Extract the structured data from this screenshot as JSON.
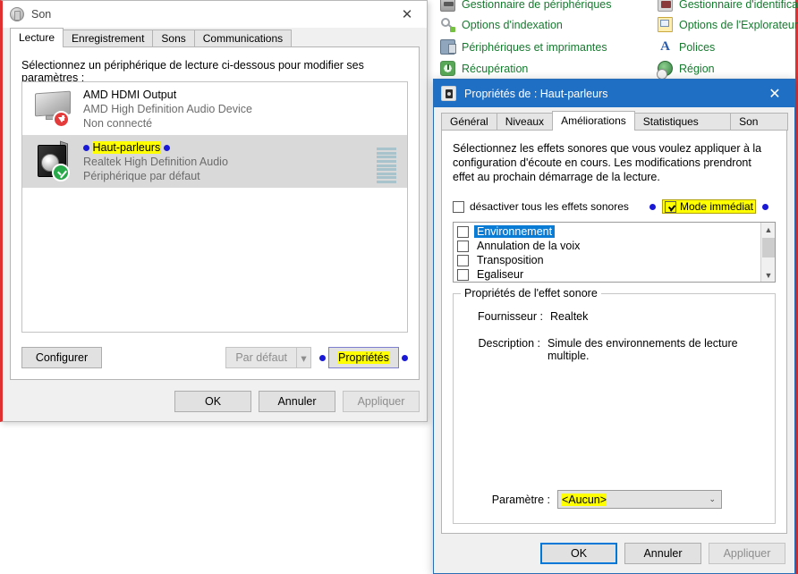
{
  "control_panel": {
    "left_column": [
      {
        "label": "Gestionnaire de périphériques",
        "icon": "device-manager-icon"
      },
      {
        "label": "Options d'indexation",
        "icon": "indexing-options-icon"
      },
      {
        "label": "Périphériques et imprimantes",
        "icon": "devices-printers-icon"
      },
      {
        "label": "Récupération",
        "icon": "recovery-icon"
      }
    ],
    "right_column": [
      {
        "label": "Gestionnaire d'identificat",
        "icon": "credential-manager-icon"
      },
      {
        "label": "Options de l'Explorateur",
        "icon": "explorer-options-icon"
      },
      {
        "label": "Polices",
        "icon": "fonts-icon"
      },
      {
        "label": "Région",
        "icon": "region-icon"
      }
    ]
  },
  "sound_window": {
    "title": "Son",
    "close_label": "✕",
    "tabs": [
      {
        "label": "Lecture",
        "active": true
      },
      {
        "label": "Enregistrement",
        "active": false
      },
      {
        "label": "Sons",
        "active": false
      },
      {
        "label": "Communications",
        "active": false
      }
    ],
    "instruction": "Sélectionnez un périphérique de lecture ci-dessous pour modifier ses paramètres :",
    "devices": [
      {
        "name": "AMD HDMI Output",
        "driver": "AMD High Definition Audio Device",
        "status": "Non connecté",
        "selected": false,
        "icon": "monitor-icon",
        "badge": "disconnected-badge"
      },
      {
        "name": "Haut-parleurs",
        "driver": "Realtek High Definition Audio",
        "status": "Périphérique par défaut",
        "selected": true,
        "icon": "speaker-icon",
        "badge": "default-device-check-badge"
      }
    ],
    "buttons": {
      "configure": "Configurer",
      "set_default": "Par défaut",
      "set_default_arrow": "▾",
      "properties": "Propriétés",
      "ok": "OK",
      "cancel": "Annuler",
      "apply": "Appliquer"
    }
  },
  "properties_dialog": {
    "title": "Propriétés de : Haut-parleurs",
    "close_label": "✕",
    "tabs": [
      {
        "label": "Général",
        "active": false
      },
      {
        "label": "Niveaux",
        "active": false
      },
      {
        "label": "Améliorations",
        "active": true
      },
      {
        "label": "Statistiques avancées",
        "active": false
      },
      {
        "label": "Son spatial",
        "active": false
      }
    ],
    "description": "Sélectionnez les effets sonores que vous voulez appliquer à la configuration d'écoute en cours. Les modifications prendront effet au prochain démarrage de la lecture.",
    "disable_all_label": "désactiver tous les effets sonores",
    "disable_all_checked": false,
    "immediate_mode_label": "Mode immédiat",
    "immediate_mode_checked": true,
    "effects": [
      {
        "label": "Environnement",
        "checked": false,
        "selected": true
      },
      {
        "label": "Annulation de la voix",
        "checked": false,
        "selected": false
      },
      {
        "label": "Transposition",
        "checked": false,
        "selected": false
      },
      {
        "label": "Egaliseur",
        "checked": false,
        "selected": false
      }
    ],
    "effect_properties": {
      "legend": "Propriétés de l'effet sonore",
      "provider_label": "Fournisseur :",
      "provider_value": "Realtek",
      "description_label": "Description :",
      "description_value": "Simule des environnements de lecture multiple.",
      "parameter_label": "Paramètre :",
      "parameter_value": "<Aucun>",
      "parameter_arrow": "⌄"
    },
    "buttons": {
      "ok": "OK",
      "cancel": "Annuler",
      "apply": "Appliquer"
    }
  },
  "colors": {
    "highlight": "#ffff00",
    "annotation_dot": "#1a1ad6",
    "title_bar": "#1f6fc4",
    "selection": "#0a7cd6",
    "border_red": "#e03030",
    "cp_link": "#157a2e"
  }
}
